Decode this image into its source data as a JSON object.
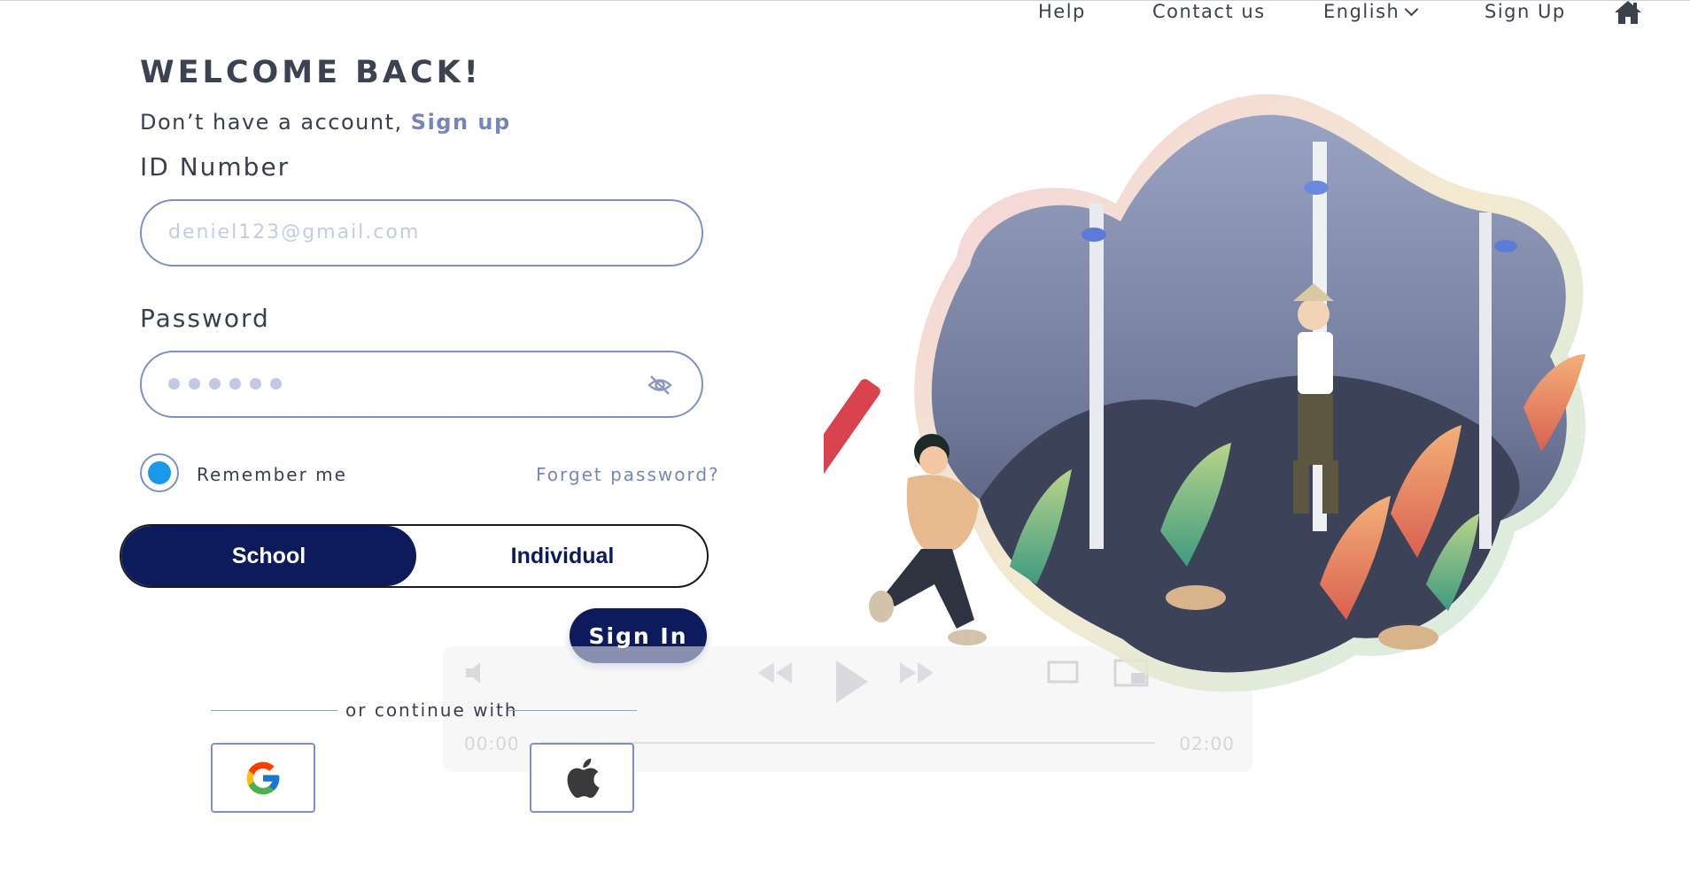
{
  "nav": {
    "help": "Help",
    "contact": "Contact us",
    "language": "English",
    "signup": "Sign Up",
    "home_icon": "home-icon"
  },
  "form": {
    "title": "WELCOME BACK!",
    "no_account_text": "Don’t have a account,",
    "no_account_link": "Sign up",
    "id_label": "ID Number",
    "id_placeholder": "deniel123@gmail.com",
    "password_label": "Password",
    "password_masked_length": 6,
    "remember_label": "Remember me",
    "remember_checked": true,
    "forget_link": "Forget password?",
    "toggle": {
      "school": "School",
      "individual": "Individual",
      "selected": "School"
    },
    "signin_button": "Sign In",
    "or_continue": "or continue with",
    "social": [
      "google-icon",
      "apple-icon"
    ]
  },
  "video": {
    "current_time": "00:00",
    "duration": "02:00"
  },
  "colors": {
    "primary": "#0d1a5c",
    "accent_link": "#7686b8",
    "input_border": "#7f8fc9",
    "radio_fill": "#1a98ea"
  }
}
